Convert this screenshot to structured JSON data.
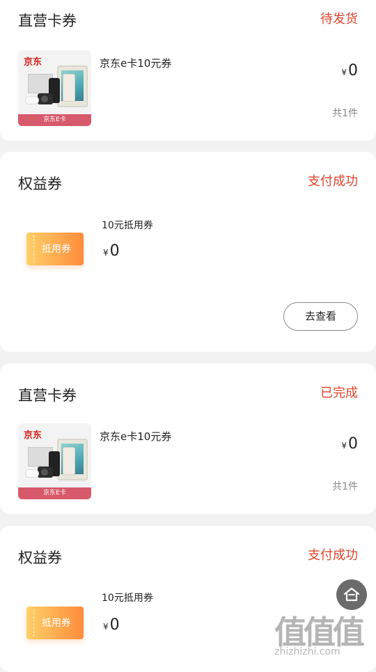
{
  "cards": [
    {
      "title": "直营卡券",
      "status": "待发货",
      "thumb": {
        "brand": "京东",
        "band": "京东E卡"
      },
      "item_name": "京东e卡10元券",
      "currency": "¥",
      "price": "0",
      "count": "共1件"
    },
    {
      "title": "权益券",
      "status": "支付成功",
      "coupon_label": "抵用券",
      "coupon_name": "10元抵用券",
      "currency": "¥",
      "price": "0",
      "view_button": "去查看"
    },
    {
      "title": "直营卡券",
      "status": "已完成",
      "thumb": {
        "brand": "京东",
        "band": "京东E卡"
      },
      "item_name": "京东e卡10元券",
      "currency": "¥",
      "price": "0",
      "count": "共1件"
    },
    {
      "title": "权益券",
      "status": "支付成功",
      "coupon_label": "抵用券",
      "coupon_name": "10元抵用券",
      "currency": "¥",
      "price": "0"
    }
  ],
  "floating_button_icon": "home-icon",
  "watermark": {
    "big": "值值值",
    "small": "zhizhizhi.com"
  },
  "colors": {
    "status": "#e0442b",
    "coupon_start": "#ffd067",
    "coupon_end": "#ff8c3c",
    "band": "#d65a6b"
  }
}
